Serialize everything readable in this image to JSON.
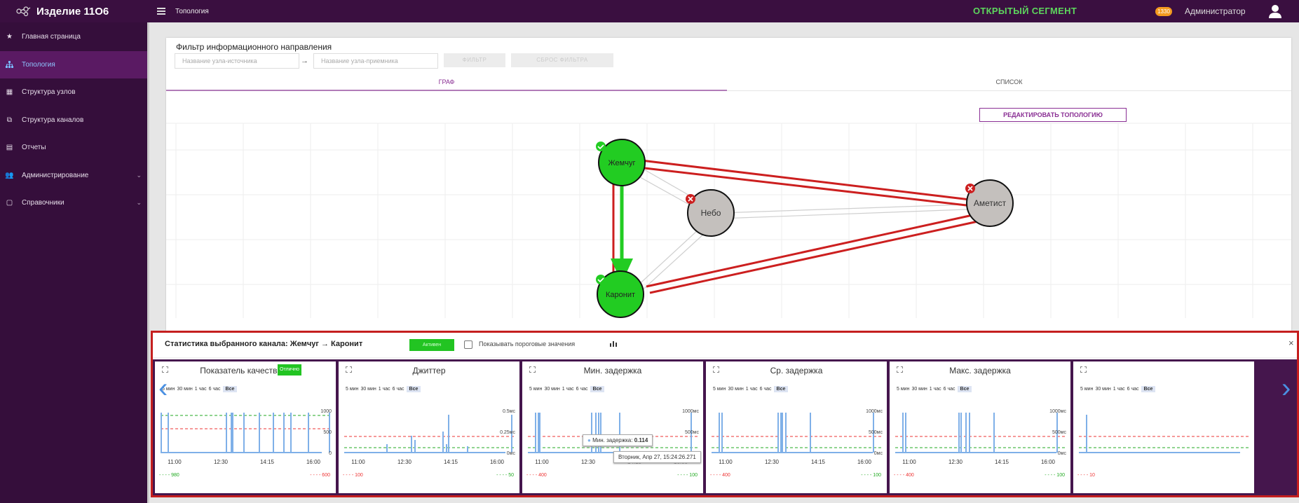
{
  "header": {
    "app_title": "Изделие 11О6",
    "breadcrumb": "Топология",
    "segment": "ОТКРЫТЫЙ СЕГМЕНТ",
    "notification_count": "1330",
    "user": "Администратор"
  },
  "sidebar": {
    "items": [
      {
        "label": "Главная страница",
        "icon": "star-icon"
      },
      {
        "label": "Топология",
        "icon": "network-icon",
        "active": true
      },
      {
        "label": "Структура узлов",
        "icon": "grid-icon"
      },
      {
        "label": "Структура каналов",
        "icon": "external-link-icon"
      },
      {
        "label": "Отчеты",
        "icon": "report-icon"
      },
      {
        "label": "Администрирование",
        "icon": "users-icon"
      },
      {
        "label": "Справочники",
        "icon": "book-icon"
      }
    ]
  },
  "filter": {
    "title": "Фильтр информационного направления",
    "source_placeholder": "Название узла-источника",
    "target_placeholder": "Название узла-приемника",
    "arrow": "→",
    "apply_label": "ФИЛЬТР",
    "reset_label": "СБРОС ФИЛЬТРА"
  },
  "tabs": [
    {
      "label": "ГРАФ",
      "active": true
    },
    {
      "label": "СПИСОК"
    }
  ],
  "edit_topology_label": "РЕДАКТИРОВАТЬ ТОПОЛОГИЮ",
  "graph": {
    "nodes": [
      {
        "name": "Жемчуг",
        "status": "ok",
        "color": "#22cc22"
      },
      {
        "name": "Небо",
        "status": "error",
        "color": "#c4c0bd"
      },
      {
        "name": "Аметист",
        "status": "error",
        "color": "#c4c0bd"
      },
      {
        "name": "Каронит",
        "status": "ok",
        "color": "#22cc22"
      }
    ],
    "colors": {
      "link_red": "#cc1f1f",
      "link_green": "#22cc22",
      "link_gray": "#cfcfcf"
    }
  },
  "stats": {
    "title": "Статистика выбранного канала: Жемчуг → Каронит",
    "status_badge": "Активен",
    "show_thresholds_label": "Показывать пороговые значения",
    "close": "×",
    "time_ranges": [
      "5 мин",
      "30 мин",
      "1 час",
      "6 час",
      "Все"
    ],
    "panels": [
      {
        "title": "Показатель качества Q",
        "badge": "Отлично",
        "y_ticks": [
          "1000",
          "500",
          "0"
        ],
        "footer_left": "980",
        "footer_right": "600"
      },
      {
        "title": "Джиттер",
        "y_ticks": [
          "0.5мс",
          "0.25мс",
          "0мс"
        ],
        "footer_left": "100",
        "footer_right": "50"
      },
      {
        "title": "Мин. задержка",
        "y_ticks": [
          "1000мс",
          "500мс",
          "0мс"
        ],
        "footer_left": "400",
        "footer_right": "100"
      },
      {
        "title": "Ср. задержка",
        "y_ticks": [
          "1000мс",
          "500мс",
          "0мс"
        ],
        "footer_left": "400",
        "footer_right": "100"
      },
      {
        "title": "Макс. задержка",
        "y_ticks": [
          "1000мс",
          "500мс",
          "0мс"
        ],
        "footer_left": "400",
        "footer_right": "100"
      },
      {
        "title": "",
        "y_ticks": [],
        "footer_left": "10",
        "footer_right": ""
      }
    ],
    "x_ticks": [
      "11:00",
      "12:30",
      "14:15",
      "16:00"
    ],
    "tooltip": {
      "label": "Мин. задержка:",
      "value": "0.114",
      "date": "Вторник, Апр 27, 15:24:26.271"
    }
  }
}
